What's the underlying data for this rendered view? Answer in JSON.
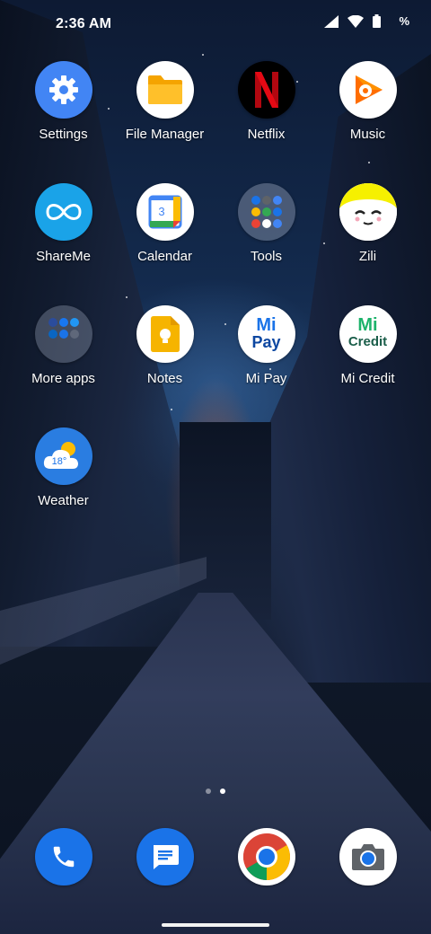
{
  "status_bar": {
    "time": "2:36 AM",
    "battery_percent": "%",
    "icons": [
      "signal-icon",
      "wifi-icon",
      "battery-icon"
    ]
  },
  "apps": [
    {
      "label": "Settings"
    },
    {
      "label": "File Manager"
    },
    {
      "label": "Netflix"
    },
    {
      "label": "Music"
    },
    {
      "label": "ShareMe"
    },
    {
      "label": "Calendar",
      "date": "3"
    },
    {
      "label": "Tools"
    },
    {
      "label": "Zili"
    },
    {
      "label": "More apps"
    },
    {
      "label": "Notes"
    },
    {
      "label": "Mi Pay",
      "logo_line1": "Mi",
      "logo_line2": "Pay"
    },
    {
      "label": "Mi Credit",
      "logo_line1": "Mi",
      "logo_line2": "Credit"
    },
    {
      "label": "Weather",
      "temp": "18°"
    }
  ],
  "page_indicator": {
    "pages": 2,
    "current": 2
  },
  "dock": [
    "phone-icon",
    "messages-icon",
    "chrome-icon",
    "camera-icon"
  ],
  "colors": {
    "settings_blue": "#4285f4",
    "netflix_red": "#e50914",
    "shareme_blue": "#1aa3e8",
    "notes_yellow": "#f6b400",
    "mi_green": "#1db36b",
    "dock_blue": "#1a73e8"
  }
}
